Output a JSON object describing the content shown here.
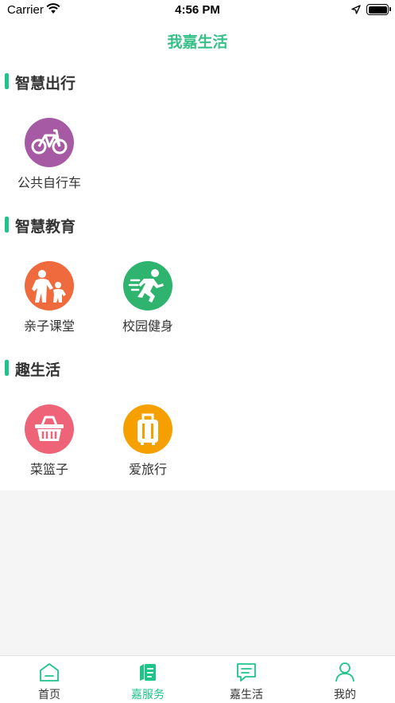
{
  "status_bar": {
    "carrier": "Carrier",
    "time": "4:56 PM"
  },
  "nav": {
    "title": "我嘉生活"
  },
  "sections": [
    {
      "title": "智慧出行",
      "items": [
        {
          "label": "公共自行车",
          "icon": "bicycle-icon",
          "color": "#a75aa4"
        }
      ]
    },
    {
      "title": "智慧教育",
      "items": [
        {
          "label": "亲子课堂",
          "icon": "parent-child-icon",
          "color": "#ef6b3d"
        },
        {
          "label": "校园健身",
          "icon": "running-icon",
          "color": "#2fb46f"
        }
      ]
    },
    {
      "title": "趣生活",
      "items": [
        {
          "label": "菜篮子",
          "icon": "basket-icon",
          "color": "#ef6378"
        },
        {
          "label": "爱旅行",
          "icon": "suitcase-icon",
          "color": "#f6a000"
        }
      ]
    }
  ],
  "tabs": [
    {
      "label": "首页",
      "icon": "home-icon",
      "active": false
    },
    {
      "label": "嘉服务",
      "icon": "service-book-icon",
      "active": true
    },
    {
      "label": "嘉生活",
      "icon": "chat-icon",
      "active": false
    },
    {
      "label": "我的",
      "icon": "user-icon",
      "active": false
    }
  ],
  "colors": {
    "accent": "#1ec48a",
    "title": "#38c089",
    "background": "#f5f5f5"
  }
}
